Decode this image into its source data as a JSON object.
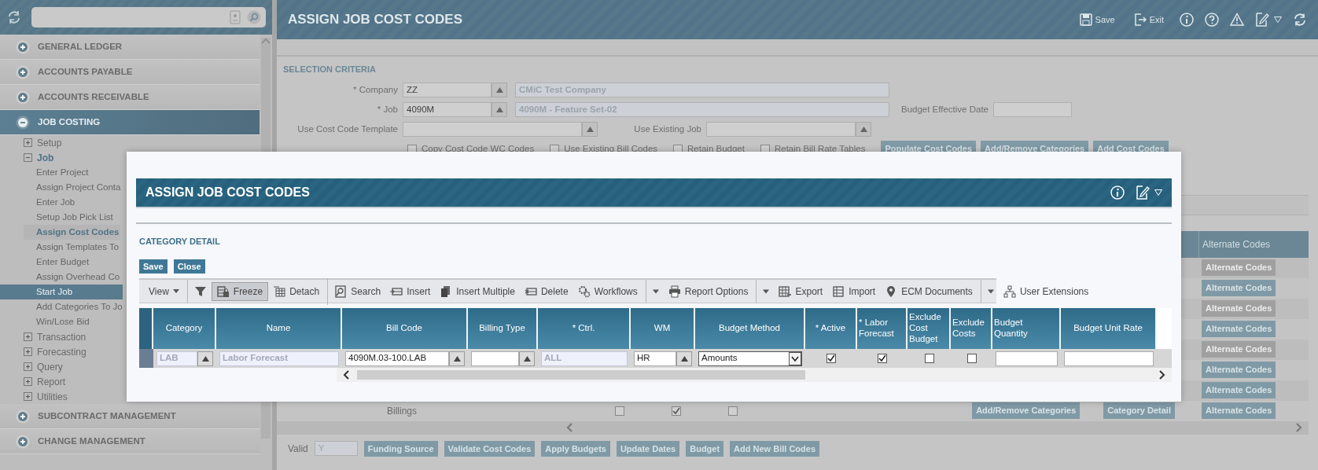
{
  "sidebar": {
    "modules": [
      {
        "label": "GENERAL LEDGER",
        "expanded": false
      },
      {
        "label": "ACCOUNTS PAYABLE",
        "expanded": false
      },
      {
        "label": "ACCOUNTS RECEIVABLE",
        "expanded": false
      },
      {
        "label": "JOB COSTING",
        "expanded": true,
        "children": [
          {
            "label": "Setup",
            "expanded": false
          },
          {
            "label": "Job",
            "expanded": true,
            "children": [
              {
                "label": "Enter Project",
                "selected": false,
                "current": false
              },
              {
                "label": "Assign Project Conta",
                "selected": false,
                "current": false
              },
              {
                "label": "Enter Job",
                "selected": false,
                "current": false
              },
              {
                "label": "Setup Job Pick List",
                "selected": false,
                "current": false
              },
              {
                "label": "Assign Cost Codes",
                "selected": false,
                "current": true
              },
              {
                "label": "Assign Templates To",
                "selected": false,
                "current": false
              },
              {
                "label": "Enter Budget",
                "selected": false,
                "current": false
              },
              {
                "label": "Assign Overhead Co",
                "selected": false,
                "current": false
              },
              {
                "label": "Start Job",
                "selected": true,
                "current": false
              },
              {
                "label": "Add Categories To Jo",
                "selected": false,
                "current": false
              },
              {
                "label": "Win/Lose Bid",
                "selected": false,
                "current": false
              }
            ]
          },
          {
            "label": "Transaction",
            "expanded": false
          },
          {
            "label": "Forecasting",
            "expanded": false
          },
          {
            "label": "Query",
            "expanded": false
          },
          {
            "label": "Report",
            "expanded": false
          },
          {
            "label": "Utilities",
            "expanded": false
          }
        ]
      },
      {
        "label": "SUBCONTRACT MANAGEMENT",
        "expanded": false
      },
      {
        "label": "CHANGE MANAGEMENT",
        "expanded": false
      }
    ]
  },
  "page": {
    "title": "ASSIGN JOB COST CODES",
    "actions": [
      "Save",
      "Exit"
    ]
  },
  "selection_criteria": {
    "title": "SELECTION CRITERIA",
    "company": {
      "label": "* Company",
      "value": "ZZ",
      "description": "CMiC Test Company"
    },
    "job": {
      "label": "* Job",
      "value": "4090M",
      "description": "4090M - Feature Set-02"
    },
    "budget_effective_date": {
      "label": "Budget Effective Date"
    },
    "cost_code_template": {
      "label": "Use Cost Code Template"
    },
    "existing_job": {
      "label": "Use Existing Job"
    },
    "options": [
      {
        "label": "Copy Cost Code WC Codes",
        "checked": false
      },
      {
        "label": "Use Existing Bill Codes",
        "checked": false
      },
      {
        "label": "Retain Budget",
        "checked": false
      },
      {
        "label": "Retain Bill Rate Tables",
        "checked": false
      }
    ],
    "buttons": [
      "Populate Cost Codes",
      "Add/Remove Categories",
      "Add Cost Codes"
    ]
  },
  "cost_code_grid": {
    "column": "Alternate Codes",
    "rows": [
      {
        "button": "Alternate Codes",
        "disabled": true
      },
      {
        "button": "Alternate Codes",
        "disabled": false
      },
      {
        "button": "Alternate Codes",
        "disabled": true
      },
      {
        "button": "Alternate Codes",
        "disabled": false
      },
      {
        "button": "Alternate Codes",
        "disabled": true
      },
      {
        "button": "Alternate Codes",
        "disabled": false
      },
      {
        "button": "Alternate Codes",
        "disabled": false
      },
      {
        "button": "Alternate Codes",
        "disabled": false,
        "name": "Billings",
        "checks": [
          false,
          true,
          false
        ],
        "actions": [
          "Add/Remove Categories",
          "Category Detail"
        ]
      }
    ]
  },
  "bottom_bar": {
    "valid_label": "Valid",
    "valid_value": "Y",
    "buttons": [
      "Funding Source",
      "Validate Cost Codes",
      "Apply Budgets",
      "Update Dates",
      "Budget",
      "Add New Bill Codes"
    ]
  },
  "dialog": {
    "title": "ASSIGN JOB COST CODES",
    "section": "CATEGORY DETAIL",
    "buttons": [
      "Save",
      "Close"
    ],
    "toolbar": [
      {
        "kind": "menu",
        "label": "View",
        "divider": false
      },
      {
        "kind": "icon",
        "divider": true
      },
      {
        "kind": "toggle",
        "label": "Freeze",
        "on": true,
        "divider": false
      },
      {
        "kind": "button",
        "label": "Detach",
        "divider": false
      },
      {
        "kind": "button",
        "label": "Search",
        "divider": true
      },
      {
        "kind": "button",
        "label": "Insert",
        "divider": false
      },
      {
        "kind": "button",
        "label": "Insert Multiple",
        "divider": false
      },
      {
        "kind": "button",
        "label": "Delete",
        "divider": false
      },
      {
        "kind": "button",
        "label": "Workflows",
        "divider": false
      },
      {
        "kind": "caret",
        "divider": true
      },
      {
        "kind": "button",
        "label": "Report Options",
        "divider": false
      },
      {
        "kind": "caret",
        "divider": true
      },
      {
        "kind": "button",
        "label": "Export",
        "divider": false
      },
      {
        "kind": "button",
        "label": "Import",
        "divider": false
      },
      {
        "kind": "button",
        "label": "ECM Documents",
        "divider": false
      },
      {
        "kind": "caret",
        "divider": true
      },
      {
        "kind": "button",
        "label": "User Extensions",
        "divider": false
      }
    ],
    "columns": [
      "Category",
      "Name",
      "Bill Code",
      "Billing Type",
      "* Ctrl.",
      "WM",
      "Budget Method",
      "* Active",
      "* Labor Forecast",
      "Exclude Cost Budget",
      "Exclude Costs",
      "Budget Quantity",
      "Budget Unit Rate"
    ],
    "rows": [
      {
        "cells": [
          {
            "kind": "lov",
            "value": "LAB",
            "disabled": true
          },
          {
            "kind": "text",
            "value": "Labor Forecast",
            "disabled": true
          },
          {
            "kind": "lov",
            "value": "4090M.03-100.LAB",
            "disabled": false
          },
          {
            "kind": "lov",
            "disabled": false
          },
          {
            "kind": "text",
            "value": "ALL",
            "disabled": true
          },
          {
            "kind": "lov",
            "value": "HR",
            "disabled": false
          },
          {
            "kind": "select",
            "value": "Amounts"
          },
          {
            "kind": "checkbox",
            "checked": true
          },
          {
            "kind": "checkbox",
            "checked": true
          },
          {
            "kind": "checkbox",
            "checked": false
          },
          {
            "kind": "checkbox",
            "checked": false
          },
          {
            "kind": "text",
            "disabled": false
          },
          {
            "kind": "text",
            "disabled": false
          }
        ]
      }
    ]
  }
}
